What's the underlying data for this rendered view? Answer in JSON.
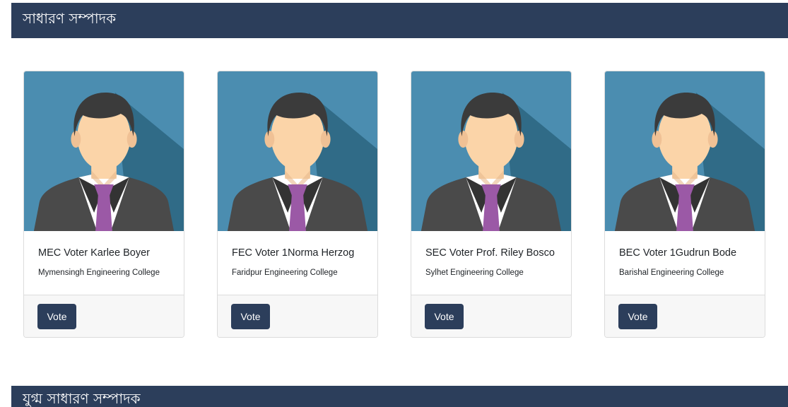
{
  "sections": [
    {
      "title": "সাধারণ সম্পাদক"
    },
    {
      "title": "যুগ্ম সাধারণ সম্পাদক"
    }
  ],
  "candidates": [
    {
      "name": "MEC Voter Karlee Boyer",
      "college": "Mymensingh Engineering College",
      "vote_label": "Vote"
    },
    {
      "name": "FEC Voter 1Norma Herzog",
      "college": "Faridpur Engineering College",
      "vote_label": "Vote"
    },
    {
      "name": "SEC Voter Prof. Riley Bosco",
      "college": "Sylhet Engineering College",
      "vote_label": "Vote"
    },
    {
      "name": "BEC Voter 1Gudrun Bode",
      "college": "Barishal Engineering College",
      "vote_label": "Vote"
    }
  ],
  "colors": {
    "header_bg": "#2c3e5b",
    "button_bg": "#2c3e5b",
    "avatar_bg": "#4b8db0",
    "avatar_shadow": "#2b6580",
    "tie": "#9b59a6",
    "suit": "#4a4a4a",
    "skin": "#fbd4a8",
    "hair": "#3b3b3b"
  },
  "icons": {
    "avatar": "user-avatar-icon"
  }
}
